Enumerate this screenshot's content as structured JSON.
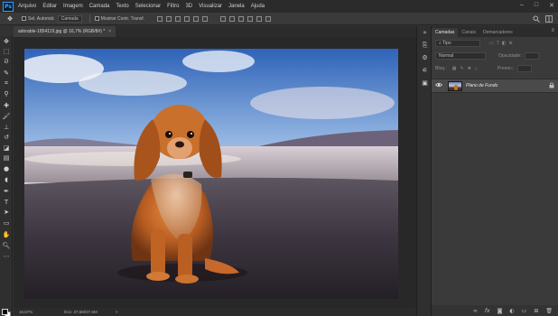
{
  "app": {
    "logo": "Ps",
    "menu": [
      "Arquivo",
      "Editar",
      "Imagem",
      "Camada",
      "Texto",
      "Selecionar",
      "Filtro",
      "3D",
      "Visualizar",
      "Janela",
      "Ajuda"
    ],
    "window_controls": [
      "–",
      "□",
      "✕"
    ]
  },
  "options_bar": {
    "auto_select_label": "Sel. Automát.",
    "auto_select_target": "Camada",
    "transform_controls_label": "Mostrar Contr. Transf."
  },
  "document": {
    "tab_title": "adorable-1854119.jpg @ 16,7% (RGB/8#) *",
    "close_glyph": "×"
  },
  "status": {
    "zoom": "16,67%",
    "doc_info": "Doc: 37,5M/37,5M",
    "arrow": ">"
  },
  "layers_panel": {
    "tabs": [
      "Camadas",
      "Canais",
      "Demarcadores"
    ],
    "menu_glyph": "≡",
    "filter_label": "Tipo",
    "blend_mode": "Normal",
    "opacity_label": "Opacidade:",
    "lock_label": "Bloq.:",
    "fill_label": "Preenc.:",
    "layers": [
      {
        "name": "Plano de Fundo",
        "visible": true,
        "locked": true
      }
    ],
    "footer_icons": [
      "link-icon",
      "fx-icon",
      "mask-icon",
      "adjustment-icon",
      "group-icon",
      "new-layer-icon",
      "trash-icon"
    ]
  },
  "toolbar_tools": [
    "move-tool",
    "marquee-tool",
    "lasso-tool",
    "quick-select-tool",
    "crop-tool",
    "eyedropper-tool",
    "healing-tool",
    "brush-tool",
    "clone-stamp-tool",
    "history-brush-tool",
    "eraser-tool",
    "gradient-tool",
    "blur-tool",
    "dodge-tool",
    "pen-tool",
    "type-tool",
    "path-select-tool",
    "rectangle-tool",
    "hand-tool",
    "zoom-tool"
  ],
  "colors": {
    "menubar_bg": "#2b2b2b",
    "panel_bg": "#3a3a3a",
    "canvas_bg": "#282828",
    "accent": "#31a8ff"
  }
}
